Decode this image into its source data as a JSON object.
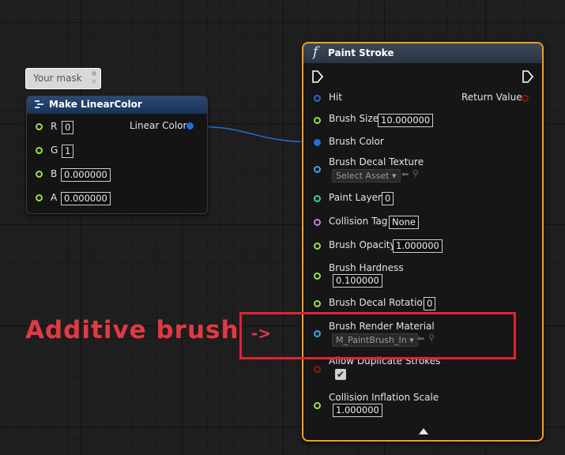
{
  "comment": {
    "text": "Your mask"
  },
  "make_linear_color": {
    "title": "Make LinearColor",
    "inputs": [
      {
        "label": "R",
        "value": "0"
      },
      {
        "label": "G",
        "value": "1"
      },
      {
        "label": "B",
        "value": "0.000000"
      },
      {
        "label": "A",
        "value": "0.000000"
      }
    ],
    "output_label": "Linear Color"
  },
  "paint_stroke": {
    "title": "Paint Stroke",
    "hit_label": "Hit",
    "return_label": "Return Value",
    "brush_size": {
      "label": "Brush Size",
      "value": "10.000000"
    },
    "brush_color": {
      "label": "Brush Color"
    },
    "brush_decal_texture": {
      "label": "Brush Decal Texture",
      "value": "Select Asset"
    },
    "paint_layer": {
      "label": "Paint Layer",
      "value": "0"
    },
    "collision_tag": {
      "label": "Collision Tag",
      "value": "None"
    },
    "brush_opacity": {
      "label": "Brush Opacity",
      "value": "1.000000"
    },
    "brush_hardness": {
      "label": "Brush Hardness",
      "value": "0.100000"
    },
    "brush_decal_rotation": {
      "label": "Brush Decal Rotation",
      "value": "0"
    },
    "brush_render_material": {
      "label": "Brush Render Material",
      "value": "M_PaintBrush_In"
    },
    "allow_duplicate_strokes": {
      "label": "Allow Duplicate Strokes",
      "checked": true
    },
    "collision_inflation_scale": {
      "label": "Collision Inflation Scale",
      "value": "1.000000"
    }
  },
  "annotation": {
    "text": "Additive brush",
    "arrow": "->"
  },
  "colors": {
    "float_pin": "#9be04a",
    "int_pin": "#2ed6b0",
    "struct_pin": "#1f6fd6",
    "object_pin": "#3aa6e8",
    "name_pin": "#c77ee8",
    "bool_pin": "#8a1414",
    "accent_selected": "#f0a023",
    "annotation_red": "#e03a44"
  }
}
